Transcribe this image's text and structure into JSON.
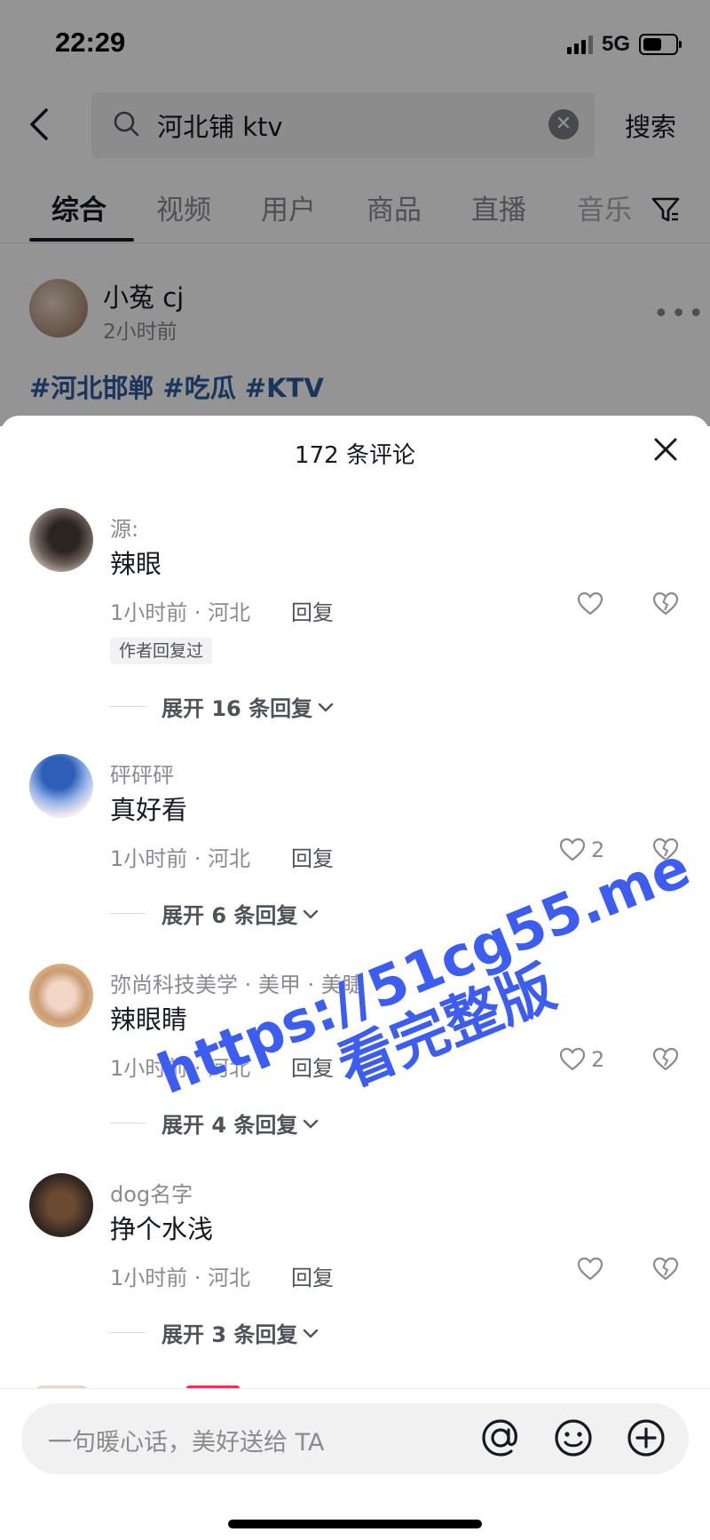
{
  "status_bar": {
    "time": "22:29",
    "network": "5G"
  },
  "search": {
    "query": "河北铺 ktv",
    "button_label": "搜索"
  },
  "tabs": [
    {
      "label": "综合",
      "active": true
    },
    {
      "label": "视频"
    },
    {
      "label": "用户"
    },
    {
      "label": "商品"
    },
    {
      "label": "直播"
    },
    {
      "label": "音乐"
    }
  ],
  "post": {
    "author": "小菟 cj",
    "time": "2小时前",
    "tags": "#河北邯郸 #吃瓜 #KTV"
  },
  "comments_sheet": {
    "title": "172 条评论",
    "comments": [
      {
        "user": "源:",
        "text": "辣眼",
        "meta": "1小时前 · 河北",
        "reply_label": "回复",
        "likes": "",
        "badge": "作者回复过",
        "expand_label": "展开 16 条回复"
      },
      {
        "user": "砰砰砰",
        "text": "真好看",
        "meta": "1小时前 · 河北",
        "reply_label": "回复",
        "likes": "2",
        "badge": "",
        "expand_label": "展开 6 条回复"
      },
      {
        "user": "弥尚科技美学 · 美甲 · 美睫",
        "text": "辣眼睛",
        "meta": "1小时前 · 河北",
        "reply_label": "回复",
        "likes": "2",
        "badge": "",
        "expand_label": "展开 4 条回复"
      },
      {
        "user": "dog名字",
        "text": "挣个水浅",
        "meta": "1小时前 · 河北",
        "reply_label": "回复",
        "likes": "",
        "badge": "",
        "expand_label": "展开 3 条回复"
      }
    ],
    "input_placeholder": "一句暖心话，美好送给 TA"
  },
  "watermark": {
    "line1": "https://51cg55.me",
    "line2": "看完整版"
  },
  "colors": {
    "accent": "#fe2c55",
    "tag": "#2d5c9e",
    "watermark": "#3d5cf0"
  }
}
